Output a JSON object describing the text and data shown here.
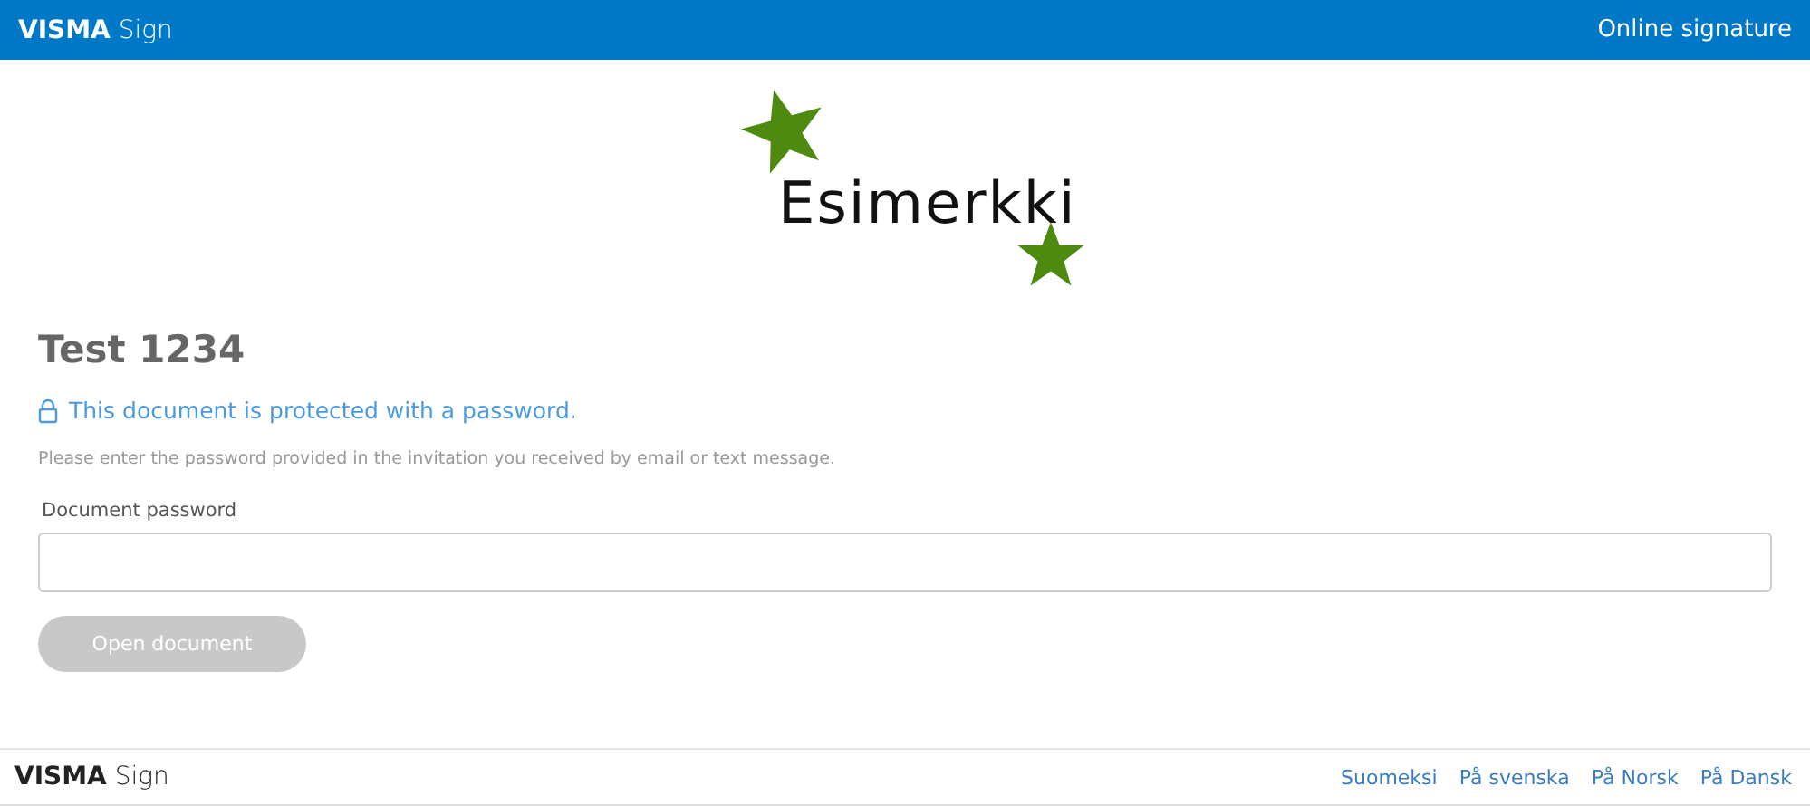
{
  "header": {
    "brand": "**VISMA** Sign",
    "title": "Online signature"
  },
  "logo": {
    "text": "Esimerkki"
  },
  "document": {
    "title": "Test 1234",
    "protected_notice": "This document is protected with a password.",
    "instructions": "Please enter the password provided in the invitation you received by email or text message.",
    "password_label": "Document password",
    "button": {
      "label": "Open document",
      "disabled": true
    }
  },
  "footer": {
    "brand": "**VISMA** Sign",
    "languages": [
      "Suomeksi",
      "På svenska",
      "På Norsk",
      "På Dansk"
    ]
  }
}
